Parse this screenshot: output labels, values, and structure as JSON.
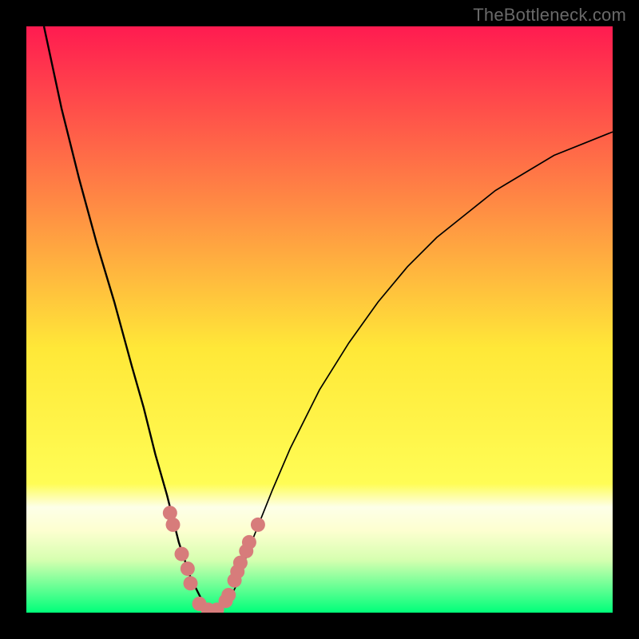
{
  "attribution": "TheBottleneck.com",
  "colors": {
    "background": "#000000",
    "curve": "#000000",
    "markers": "#d77c7b",
    "gradient_top": "#ff1b50",
    "gradient_mid_upper": "#ff8944",
    "gradient_mid": "#ffe838",
    "gradient_mid_lower": "#fffd55",
    "gradient_band_light": "#fdffd0",
    "gradient_bottom": "#00ff7a"
  },
  "chart_data": {
    "type": "line",
    "title": "",
    "xlabel": "",
    "ylabel": "",
    "xlim": [
      0,
      100
    ],
    "ylim": [
      0,
      100
    ],
    "series": [
      {
        "name": "curve-left",
        "x": [
          3,
          6,
          9,
          12,
          15,
          18,
          20,
          22,
          24,
          25,
          26,
          27,
          28,
          29,
          30,
          31,
          32
        ],
        "values": [
          100,
          86,
          74,
          63,
          53,
          42,
          35,
          27,
          20,
          16,
          12,
          9,
          6,
          4,
          2,
          1,
          0
        ]
      },
      {
        "name": "curve-right",
        "x": [
          32,
          33,
          34,
          35,
          36,
          37,
          38,
          40,
          42,
          45,
          50,
          55,
          60,
          65,
          70,
          75,
          80,
          85,
          90,
          95,
          100
        ],
        "values": [
          0,
          1,
          2,
          3,
          5,
          8,
          11,
          16,
          21,
          28,
          38,
          46,
          53,
          59,
          64,
          68,
          72,
          75,
          78,
          80,
          82
        ]
      },
      {
        "name": "markers",
        "x": [
          24.5,
          25,
          26.5,
          27.5,
          28,
          29.5,
          31,
          32.5,
          34,
          34.5,
          35.5,
          36,
          36.5,
          37.5,
          38,
          39.5
        ],
        "values": [
          17,
          15,
          10,
          7.5,
          5,
          1.5,
          0.5,
          0.5,
          2,
          3,
          5.5,
          7,
          8.5,
          10.5,
          12,
          15
        ]
      }
    ]
  }
}
